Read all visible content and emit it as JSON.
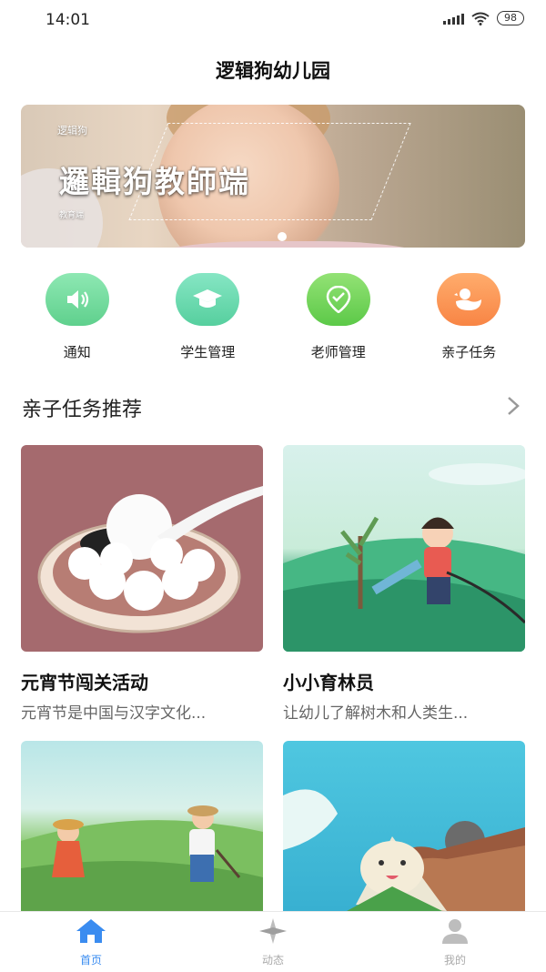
{
  "status": {
    "time": "14:01",
    "battery": "98"
  },
  "header": {
    "title": "逻辑狗幼儿园"
  },
  "banner": {
    "headline": "邏輯狗教師端",
    "brand_small": "逻辑狗",
    "sub_small": "教育端"
  },
  "shortcuts": [
    {
      "label": "通知",
      "icon": "speaker-icon",
      "color": "#7ee0a6"
    },
    {
      "label": "学生管理",
      "icon": "graduation-cap-icon",
      "color": "#6fdcb4"
    },
    {
      "label": "老师管理",
      "icon": "location-check-icon",
      "color": "#7fd76a"
    },
    {
      "label": "亲子任务",
      "icon": "duck-icon",
      "color": "#ff9a5a"
    }
  ],
  "section": {
    "title": "亲子任务推荐"
  },
  "cards": [
    {
      "title": "元宵节闯关活动",
      "desc": "元宵节是中国与汉字文化...",
      "image": "tangyuan-illustration"
    },
    {
      "title": "小小育林员",
      "desc": "让幼儿了解树木和人类生...",
      "image": "watering-tree-illustration"
    },
    {
      "title": "",
      "desc": "",
      "image": "farming-illustration"
    },
    {
      "title": "",
      "desc": "",
      "image": "zongzi-illustration"
    }
  ],
  "tabbar": [
    {
      "label": "首页",
      "icon": "home-icon",
      "active": true
    },
    {
      "label": "动态",
      "icon": "compass-icon",
      "active": false
    },
    {
      "label": "我的",
      "icon": "person-icon",
      "active": false
    }
  ]
}
